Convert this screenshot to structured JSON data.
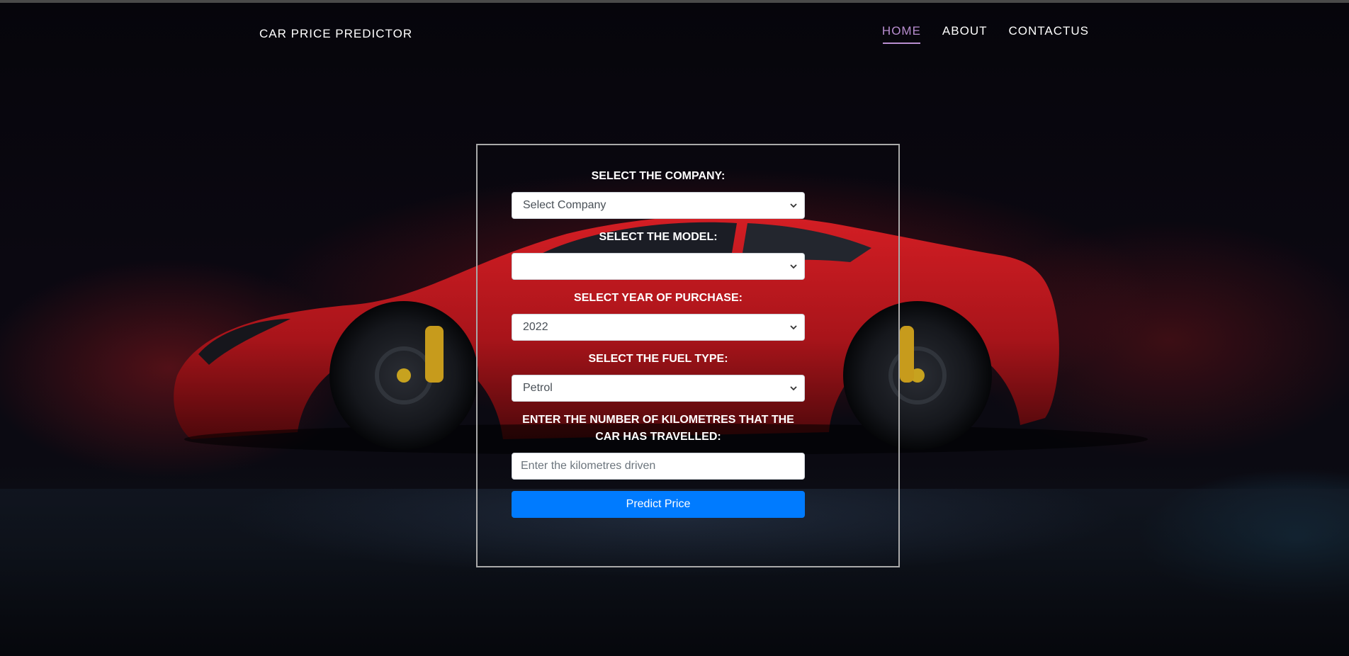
{
  "header": {
    "brand": "CAR PRICE PREDICTOR",
    "nav": [
      {
        "label": "HOME",
        "active": true
      },
      {
        "label": "ABOUT",
        "active": false
      },
      {
        "label": "CONTACTUS",
        "active": false
      }
    ]
  },
  "form": {
    "company_label": "SELECT THE COMPANY:",
    "company_value": "Select Company",
    "model_label": "SELECT THE MODEL:",
    "model_value": "",
    "year_label": "SELECT YEAR OF PURCHASE:",
    "year_value": "2022",
    "fuel_label": "SELECT THE FUEL TYPE:",
    "fuel_value": "Petrol",
    "km_label": "ENTER THE NUMBER OF KILOMETRES THAT THE CAR HAS TRAVELLED:",
    "km_placeholder": "Enter the kilometres driven",
    "submit_label": "Predict Price"
  },
  "colors": {
    "nav_active": "#b98ed1",
    "button": "#007bff",
    "car_body": "#c0161d"
  },
  "icons": {
    "select_chevron": "chevron-down-icon",
    "background": "red-sports-car-image"
  }
}
